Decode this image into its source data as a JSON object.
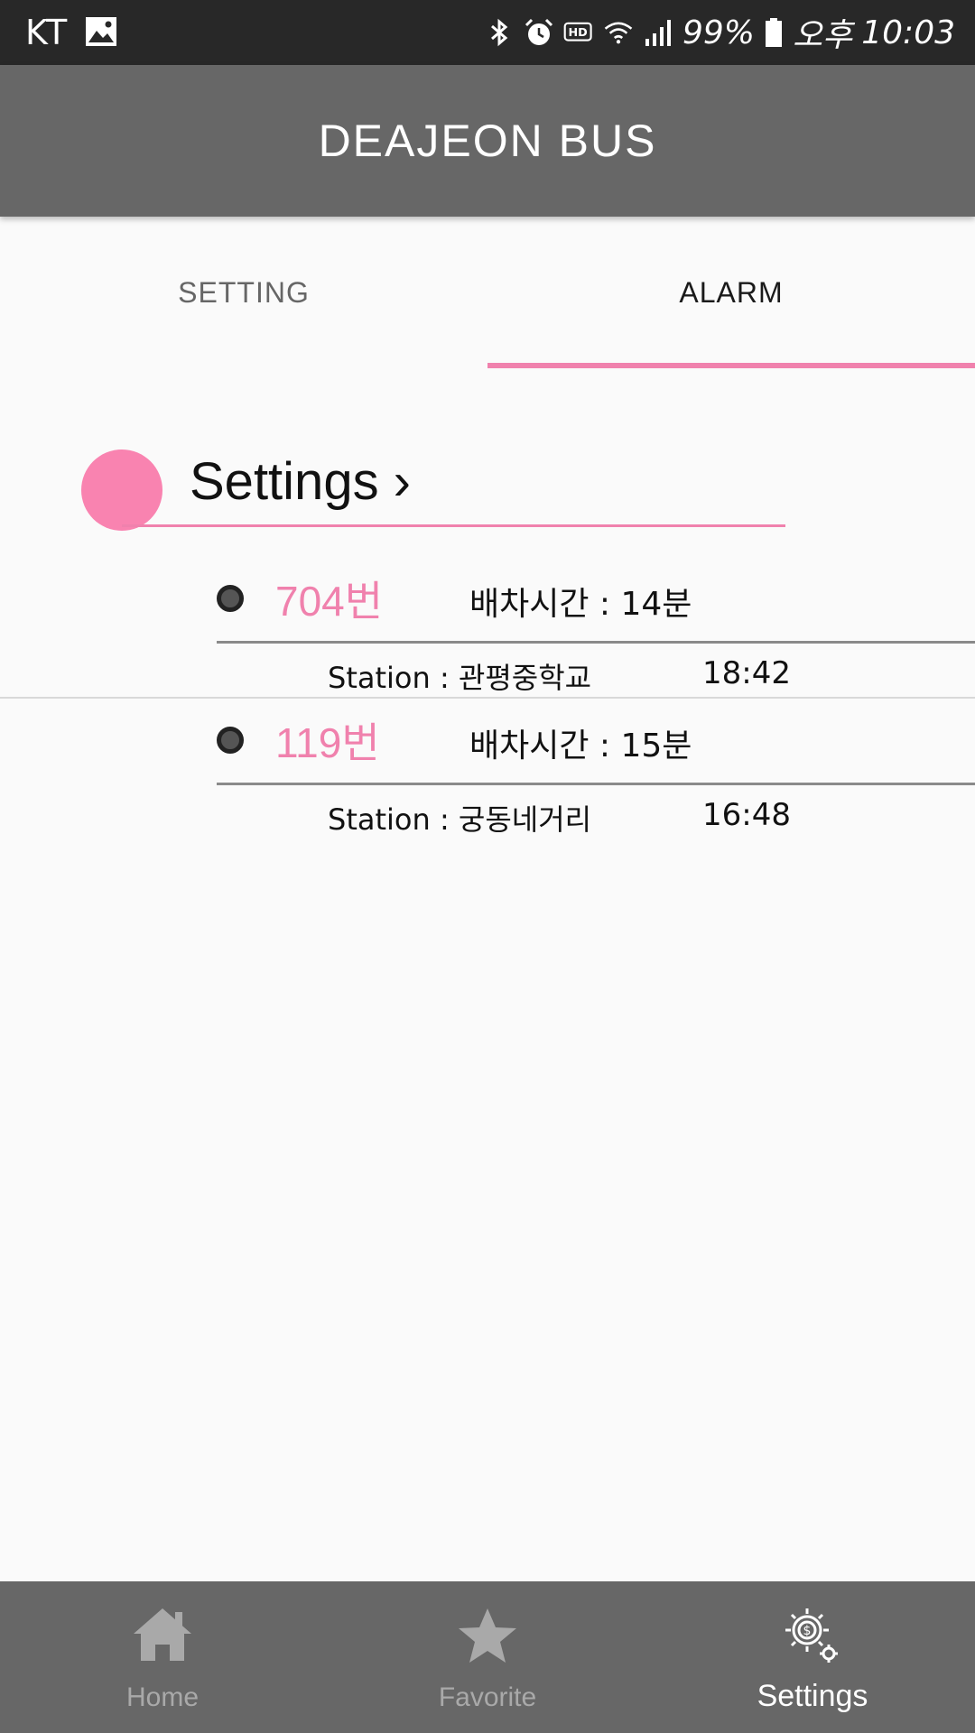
{
  "status_bar": {
    "carrier": "KT",
    "battery_percent": "99%",
    "ampm": "오후",
    "time": "10:03",
    "icons": [
      "gallery-icon",
      "bluetooth-icon",
      "alarm-icon",
      "hd-icon",
      "wifi-icon",
      "signal-icon",
      "battery-icon"
    ]
  },
  "app_bar": {
    "title": "DEAJEON BUS"
  },
  "tabs": [
    {
      "label": "SETTING",
      "selected": false
    },
    {
      "label": "ALARM",
      "selected": true
    }
  ],
  "colors": {
    "accent": "#f081ad",
    "app_bar": "#676767",
    "status_bar": "#282828",
    "dot": "#f983b0"
  },
  "section": {
    "title": "Settings ›"
  },
  "alarms": [
    {
      "bus": "704번",
      "interval": "배차시간 : 14분",
      "station": "Station : 관평중학교",
      "time": "18:42"
    },
    {
      "bus": "119번",
      "interval": "배차시간 : 15분",
      "station": "Station : 궁동네거리",
      "time": "16:48"
    }
  ],
  "bottom_nav": [
    {
      "label": "Home",
      "icon": "home-icon",
      "active": false
    },
    {
      "label": "Favorite",
      "icon": "star-icon",
      "active": false
    },
    {
      "label": "Settings",
      "icon": "gear-icon",
      "active": true
    }
  ]
}
